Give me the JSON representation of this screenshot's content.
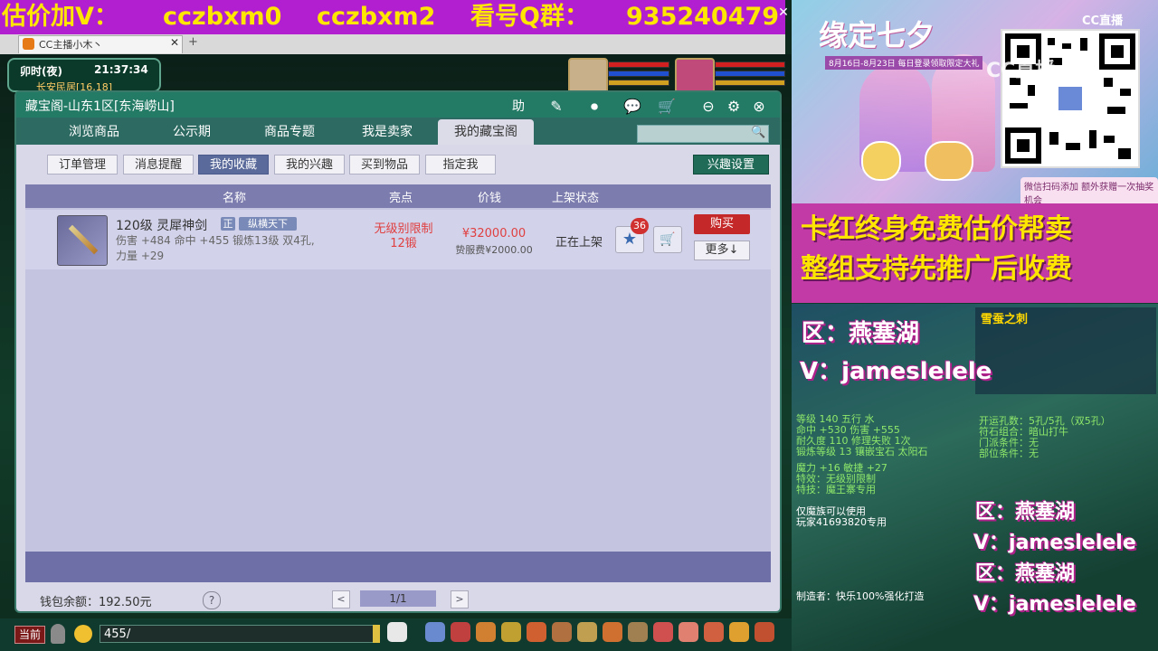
{
  "banner": {
    "p1": "估价加V：",
    "p2": "cczbxm0",
    "p3": "cczbxm2",
    "p4": "看号Q群：",
    "p5": "935240479",
    "close": "✕"
  },
  "browser": {
    "tab_title": "CC主播小木丶",
    "tab_close": "✕",
    "new_tab": "+"
  },
  "hud": {
    "time_label": "卯时(夜)",
    "clock": "21:37:34",
    "map": "长安民居[16,18]"
  },
  "dialog": {
    "title": "藏宝阁-山东1区[东海崂山]",
    "help_icon": "助",
    "main_tabs": [
      "浏览商品",
      "公示期",
      "商品专题",
      "我是卖家",
      "我的藏宝阁"
    ],
    "sub_tabs": [
      "订单管理",
      "消息提醒",
      "我的收藏",
      "我的兴趣",
      "买到物品",
      "指定我"
    ],
    "interest_settings": "兴趣设置",
    "columns": [
      "名称",
      "亮点",
      "价钱",
      "上架状态"
    ],
    "item": {
      "name": "120级 灵犀神剑",
      "tag_zheng": "正",
      "tag_server": "纵横天下",
      "stats_1": "伤害 +484 命中 +455 锻炼13级 双4孔,",
      "stats_2": "力量 +29",
      "feature_1": "无级别限制",
      "feature_2": "12锻",
      "price": "¥32000.00",
      "fee": "贽服费¥2000.00",
      "status": "正在上架",
      "fav_count": "36",
      "buy": "购买",
      "more": "更多↓"
    },
    "wallet": "钱包余额：192.50元",
    "help": "?",
    "page": "1/1",
    "prev": "<",
    "next": ">"
  },
  "bottom": {
    "channel": "当前",
    "input_value": "455/"
  },
  "promo": {
    "event_title": "缘定七夕",
    "event_date": "8月16日-8月23日 每日登录领取限定大礼",
    "cc_logo": "CC直播",
    "cc_overlay": "CC直播",
    "bottom_note": "微信扫码添加 额外获赠一次抽奖机会",
    "line1": "卡红终身免费估价帮卖",
    "line2": "整组支持先推广后收费",
    "wm_zone": "区：燕塞湖",
    "wm_v": "V：jameslelele",
    "game_item_title": "雪蚕之刺",
    "game_lines": [
      "等级 140  五行 水",
      "命中 +530 伤害 +555",
      "耐久度 110  修理失败 1次",
      "锻炼等级 13  镶嵌宝石 太阳石",
      "魔力 +16 敏捷 +27",
      "特效：无级别限制",
      "特技：魔王寨专用",
      "仅魔族可以使用",
      "玩家41693820专用",
      "制造者：快乐100%强化打造"
    ],
    "game_right_lines": [
      "开运孔数：5孔/5孔（双5孔）",
      "符石组合：暗山打牛",
      "门派条件：无",
      "部位条件：无"
    ]
  }
}
